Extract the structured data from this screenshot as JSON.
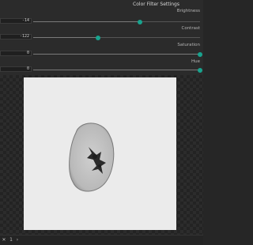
{
  "panel": {
    "title": "Color Filter Settings",
    "accent_color": "#18a38e",
    "sliders": [
      {
        "label": "Brightness",
        "value": "-14",
        "level": 0.64
      },
      {
        "label": "Contrast",
        "value": "-122",
        "level": 0.39
      },
      {
        "label": "Saturation",
        "value": "0",
        "level": 1.0
      },
      {
        "label": "Hue",
        "value": "0",
        "level": 1.0
      }
    ]
  },
  "bottombar": {
    "close_icon": "close-icon",
    "page_label": "1",
    "close_text": "✕",
    "arrow_text": "›"
  }
}
